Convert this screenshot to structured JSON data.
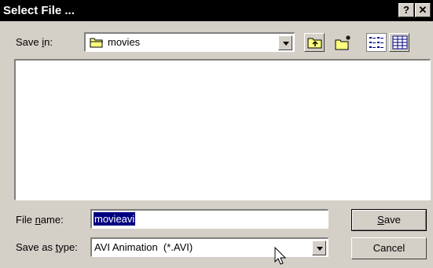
{
  "window": {
    "title": "Select File ...",
    "help_glyph": "?",
    "close_glyph": "✕"
  },
  "save_in": {
    "label_pre": "Save ",
    "label_key": "i",
    "label_post": "n:",
    "value": "movies"
  },
  "file_name": {
    "label_pre": "File ",
    "label_key": "n",
    "label_post": "ame:",
    "value": "movieavi"
  },
  "save_as_type": {
    "label_pre": "Save as ",
    "label_key": "t",
    "label_post": "ype:",
    "value": "AVI Animation  (*.AVI)"
  },
  "buttons": {
    "save_key": "S",
    "save_rest": "ave",
    "cancel": "Cancel"
  },
  "icons": {
    "folder": "folder-icon",
    "up_folder": "up-one-level-icon",
    "new_folder": "create-new-folder-icon",
    "list_view": "list-view-icon",
    "details_view": "details-view-icon",
    "cursor": "mouse-pointer-icon"
  }
}
